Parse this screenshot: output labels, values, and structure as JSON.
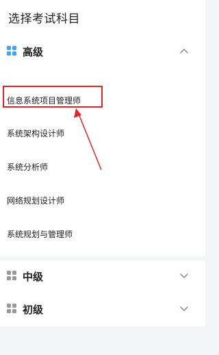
{
  "header": {
    "title": "选择考试科目"
  },
  "sections": [
    {
      "label": "高级",
      "expanded": true,
      "icon": "grid-icon",
      "icon_color": "#3aa7f0",
      "items": [
        "信息系统项目管理师",
        "系统架构设计师",
        "系统分析师",
        "网络规划设计师",
        "系统规划与管理师"
      ]
    },
    {
      "label": "中级",
      "expanded": false,
      "icon": "grid-icon",
      "icon_color": "#9a9a9a",
      "items": []
    },
    {
      "label": "初级",
      "expanded": false,
      "icon": "grid-icon",
      "icon_color": "#9a9a9a",
      "items": []
    }
  ],
  "annotation": {
    "highlight_color": "#e02424",
    "highlighted_item": "信息系统项目管理师"
  }
}
